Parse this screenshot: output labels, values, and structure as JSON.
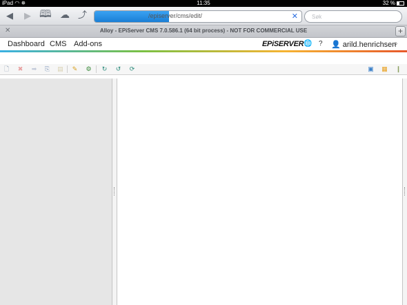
{
  "status_bar": {
    "device": "iPad",
    "wifi_icon": "wifi-icon",
    "time": "11:35",
    "battery": "32 %"
  },
  "browser": {
    "url": "/episerver/cms/edit/",
    "search_placeholder": "Søk",
    "tab_title": "Alloy - EPiServer CMS 7.0.586.1 (64 bit process) - NOT FOR COMMERCIAL USE",
    "progress_fraction": 0.36
  },
  "nav": {
    "items": [
      "Dashboard",
      "CMS",
      "Add-ons"
    ],
    "brand": "EPiSERVER",
    "help": "?",
    "user": "arild.henrichsen"
  },
  "toolbar": {
    "icons": [
      "new-page-icon",
      "delete-icon",
      "move-icon",
      "copy-icon",
      "paste-icon",
      "settings-icon",
      "tools-icon",
      "refresh-icon",
      "view-icon",
      "publish-icon"
    ]
  },
  "colors": {
    "stripe": [
      "#3ab0e2",
      "#7ac043",
      "#f6b332",
      "#e7582a"
    ],
    "progress": "#1a7fd6"
  }
}
